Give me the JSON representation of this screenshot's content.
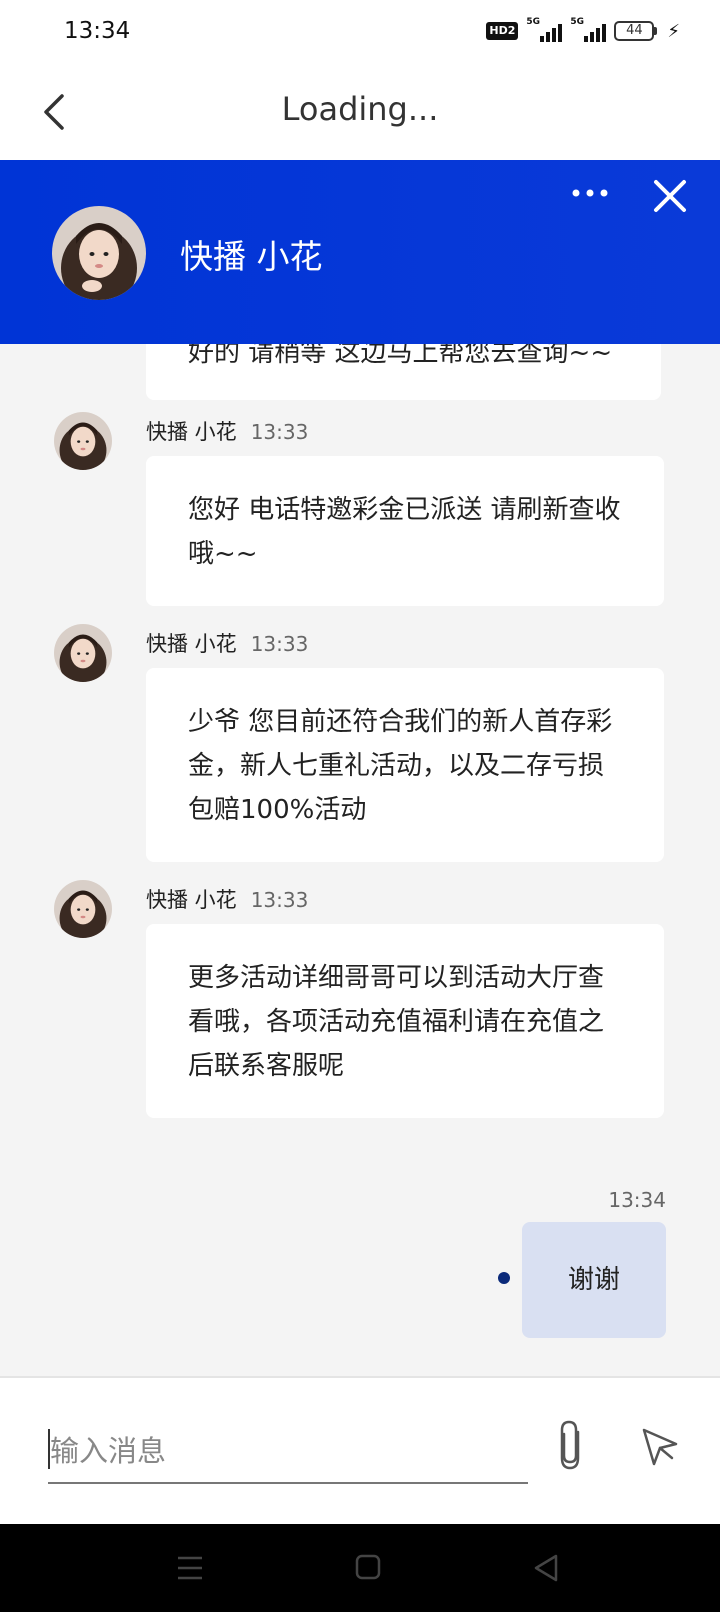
{
  "status_bar": {
    "time": "13:34",
    "hd": "HD2",
    "net1": "5G",
    "net2": "5G",
    "battery": "44"
  },
  "nav": {
    "title": "Loading..."
  },
  "chat": {
    "agent_name": "快播 小花",
    "partial_message": "好的 请稍等 这边马上帮您去查询~~",
    "messages": [
      {
        "sender": "快播 小花",
        "time": "13:33",
        "text": "您好 电话特邀彩金已派送 请刷新查收哦~~"
      },
      {
        "sender": "快播 小花",
        "time": "13:33",
        "text": "少爷 您目前还符合我们的新人首存彩金，新人七重礼活动，以及二存亏损包赔100%活动"
      },
      {
        "sender": "快播 小花",
        "time": "13:33",
        "text": "更多活动详细哥哥可以到活动大厅查看哦，各项活动充值福利请在充值之后联系客服呢"
      }
    ],
    "my_message": {
      "time": "13:34",
      "text": "谢谢"
    }
  },
  "input": {
    "placeholder": "输入消息"
  },
  "colors": {
    "header_blue": "#0034d6",
    "my_bubble": "#d9e0f2",
    "unread_dot": "#0b2a7a"
  }
}
